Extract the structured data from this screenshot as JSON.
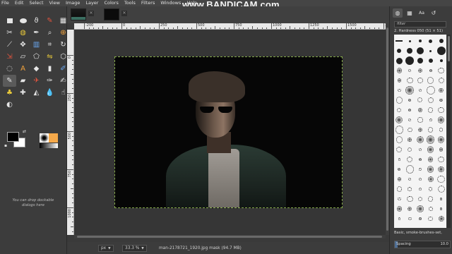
{
  "menu": [
    "File",
    "Edit",
    "Select",
    "View",
    "Image",
    "Layer",
    "Colors",
    "Tools",
    "Filters",
    "Windows",
    "Help"
  ],
  "watermark": "www.BANDICAM.com",
  "toolbox": {
    "tools": [
      {
        "name": "rect-select-icon",
        "glyph": "",
        "kind": "rect"
      },
      {
        "name": "ellipse-select-icon",
        "glyph": "",
        "kind": "ell"
      },
      {
        "name": "free-select-icon",
        "glyph": "ϑ",
        "kind": "glyph"
      },
      {
        "name": "fuzzy-select-icon",
        "glyph": "✎",
        "kind": "glyph"
      },
      {
        "name": "select-by-color-icon",
        "glyph": "▦",
        "kind": "glyph"
      },
      {
        "name": "scissors-icon",
        "glyph": "✂",
        "kind": "glyph"
      },
      {
        "name": "foreground-select-icon",
        "glyph": "◍",
        "kind": "glyph"
      },
      {
        "name": "paths-icon",
        "glyph": "✒",
        "kind": "glyph"
      },
      {
        "name": "color-picker-icon",
        "glyph": "⌕",
        "kind": "glyph"
      },
      {
        "name": "zoom-icon",
        "glyph": "⊕",
        "kind": "glyph"
      },
      {
        "name": "measure-icon",
        "glyph": "⟋",
        "kind": "glyph"
      },
      {
        "name": "move-icon",
        "glyph": "✥",
        "kind": "glyph"
      },
      {
        "name": "align-icon",
        "glyph": "▥",
        "kind": "glyph"
      },
      {
        "name": "crop-icon",
        "glyph": "⌗",
        "kind": "glyph"
      },
      {
        "name": "rotate-icon",
        "glyph": "↻",
        "kind": "glyph"
      },
      {
        "name": "scale-icon",
        "glyph": "⇲",
        "kind": "glyph"
      },
      {
        "name": "shear-icon",
        "glyph": "▱",
        "kind": "glyph"
      },
      {
        "name": "perspective-icon",
        "glyph": "⬠",
        "kind": "glyph"
      },
      {
        "name": "flip-icon",
        "glyph": "⇋",
        "kind": "glyph"
      },
      {
        "name": "cage-icon",
        "glyph": "⬡",
        "kind": "glyph"
      },
      {
        "name": "warp-icon",
        "glyph": "◌",
        "kind": "glyph"
      },
      {
        "name": "text-icon",
        "glyph": "A",
        "kind": "glyph"
      },
      {
        "name": "bucket-fill-icon",
        "glyph": "◆",
        "kind": "glyph"
      },
      {
        "name": "blend-icon",
        "glyph": "▮",
        "kind": "glyph"
      },
      {
        "name": "pencil-icon",
        "glyph": "✐",
        "kind": "glyph"
      },
      {
        "name": "paintbrush-icon",
        "glyph": "✎",
        "kind": "glyph",
        "active": true
      },
      {
        "name": "eraser-icon",
        "glyph": "▰",
        "kind": "glyph"
      },
      {
        "name": "airbrush-icon",
        "glyph": "✈",
        "kind": "glyph"
      },
      {
        "name": "ink-icon",
        "glyph": "✑",
        "kind": "glyph"
      },
      {
        "name": "mypaint-brush-icon",
        "glyph": "✍",
        "kind": "glyph"
      },
      {
        "name": "clone-icon",
        "glyph": "♣",
        "kind": "glyph"
      },
      {
        "name": "heal-icon",
        "glyph": "✚",
        "kind": "glyph"
      },
      {
        "name": "perspective-clone-icon",
        "glyph": "◭",
        "kind": "glyph"
      },
      {
        "name": "blur-icon",
        "glyph": "💧",
        "kind": "glyph"
      },
      {
        "name": "smudge-icon",
        "glyph": "☝",
        "kind": "glyph"
      },
      {
        "name": "dodge-burn-icon",
        "glyph": "◐",
        "kind": "glyph"
      }
    ],
    "drop_hint": "You can drop dockable dialogs here"
  },
  "tabs": {
    "close_glyph": "✕"
  },
  "rulers": {
    "top": [
      "-200",
      "0",
      "250",
      "500",
      "750",
      "1000",
      "1250",
      "1500",
      "1750"
    ],
    "left": [
      "0",
      "250",
      "500",
      "750",
      "1000"
    ]
  },
  "status": {
    "unit": "px",
    "zoom": "33.3 %",
    "message": "man-2178721_1920.jpg mask (94.7 MB)"
  },
  "dock": {
    "tabs": [
      "brushes-icon",
      "patterns-icon",
      "fonts-icon",
      "document-history-icon"
    ],
    "filter_placeholder": "filter",
    "brush_name": "2. Hardness 050 (51 × 51)",
    "tag_field": "Basic, smoke-brushes-set,",
    "spacing_label": "Spacing",
    "spacing_value": "10.0",
    "spacing_fraction": 0.05
  }
}
